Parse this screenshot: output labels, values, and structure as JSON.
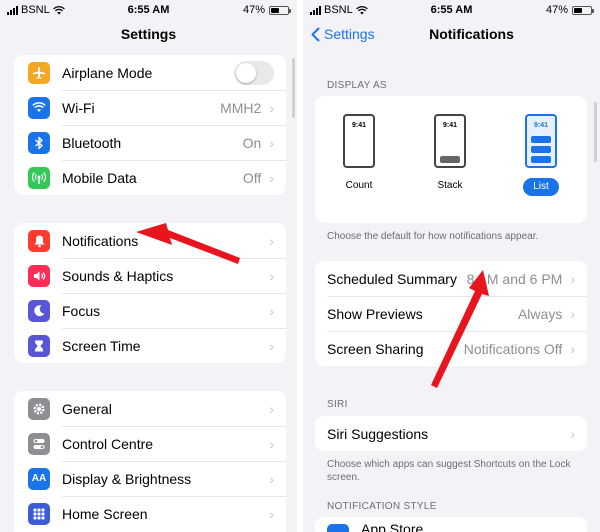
{
  "left": {
    "status": {
      "carrier": "BSNL",
      "time": "6:55 AM",
      "battery": "47%",
      "battery_level": 0.47
    },
    "title": "Settings",
    "group1": [
      {
        "label": "Airplane Mode",
        "icon": "airplane-icon",
        "color": "#f5a623",
        "toggle": true
      },
      {
        "label": "Wi-Fi",
        "value": "MMH2",
        "icon": "wifi-icon",
        "color": "#1a73e8"
      },
      {
        "label": "Bluetooth",
        "value": "On",
        "icon": "bluetooth-icon",
        "color": "#1a73e8"
      },
      {
        "label": "Mobile Data",
        "value": "Off",
        "icon": "antenna-icon",
        "color": "#34c759"
      }
    ],
    "group2": [
      {
        "label": "Notifications",
        "icon": "bell-icon",
        "color": "#ff3b30"
      },
      {
        "label": "Sounds & Haptics",
        "icon": "speaker-icon",
        "color": "#ff2d55"
      },
      {
        "label": "Focus",
        "icon": "moon-icon",
        "color": "#5856d6"
      },
      {
        "label": "Screen Time",
        "icon": "hourglass-icon",
        "color": "#5856d6"
      }
    ],
    "group3": [
      {
        "label": "General",
        "icon": "gear-icon",
        "color": "#8e8e93"
      },
      {
        "label": "Control Centre",
        "icon": "switches-icon",
        "color": "#8e8e93"
      },
      {
        "label": "Display & Brightness",
        "icon": "text-size-icon",
        "color": "#1a73e8",
        "glyph": "AA"
      },
      {
        "label": "Home Screen",
        "icon": "grid-icon",
        "color": "#3c5bd6"
      }
    ]
  },
  "right": {
    "status": {
      "carrier": "BSNL",
      "time": "6:55 AM",
      "battery": "47%",
      "battery_level": 0.47
    },
    "back_label": "Settings",
    "title": "Notifications",
    "display_as_header": "DISPLAY AS",
    "display_options": [
      {
        "label": "Count",
        "phone_time": "9:41"
      },
      {
        "label": "Stack",
        "phone_time": "9:41"
      },
      {
        "label": "List",
        "phone_time": "9:41",
        "selected": true
      }
    ],
    "display_footnote": "Choose the default for how notifications appear.",
    "group1": [
      {
        "label": "Scheduled Summary",
        "value": "8 AM and 6 PM"
      },
      {
        "label": "Show Previews",
        "value": "Always"
      },
      {
        "label": "Screen Sharing",
        "value": "Notifications Off"
      }
    ],
    "siri_header": "SIRI",
    "siri_row": {
      "label": "Siri Suggestions"
    },
    "siri_footnote": "Choose which apps can suggest Shortcuts on the Lock screen.",
    "style_header": "NOTIFICATION STYLE",
    "partial_row": "App Store"
  },
  "colors": {
    "accent": "#1a73e8",
    "arrow": "#e8141e"
  }
}
